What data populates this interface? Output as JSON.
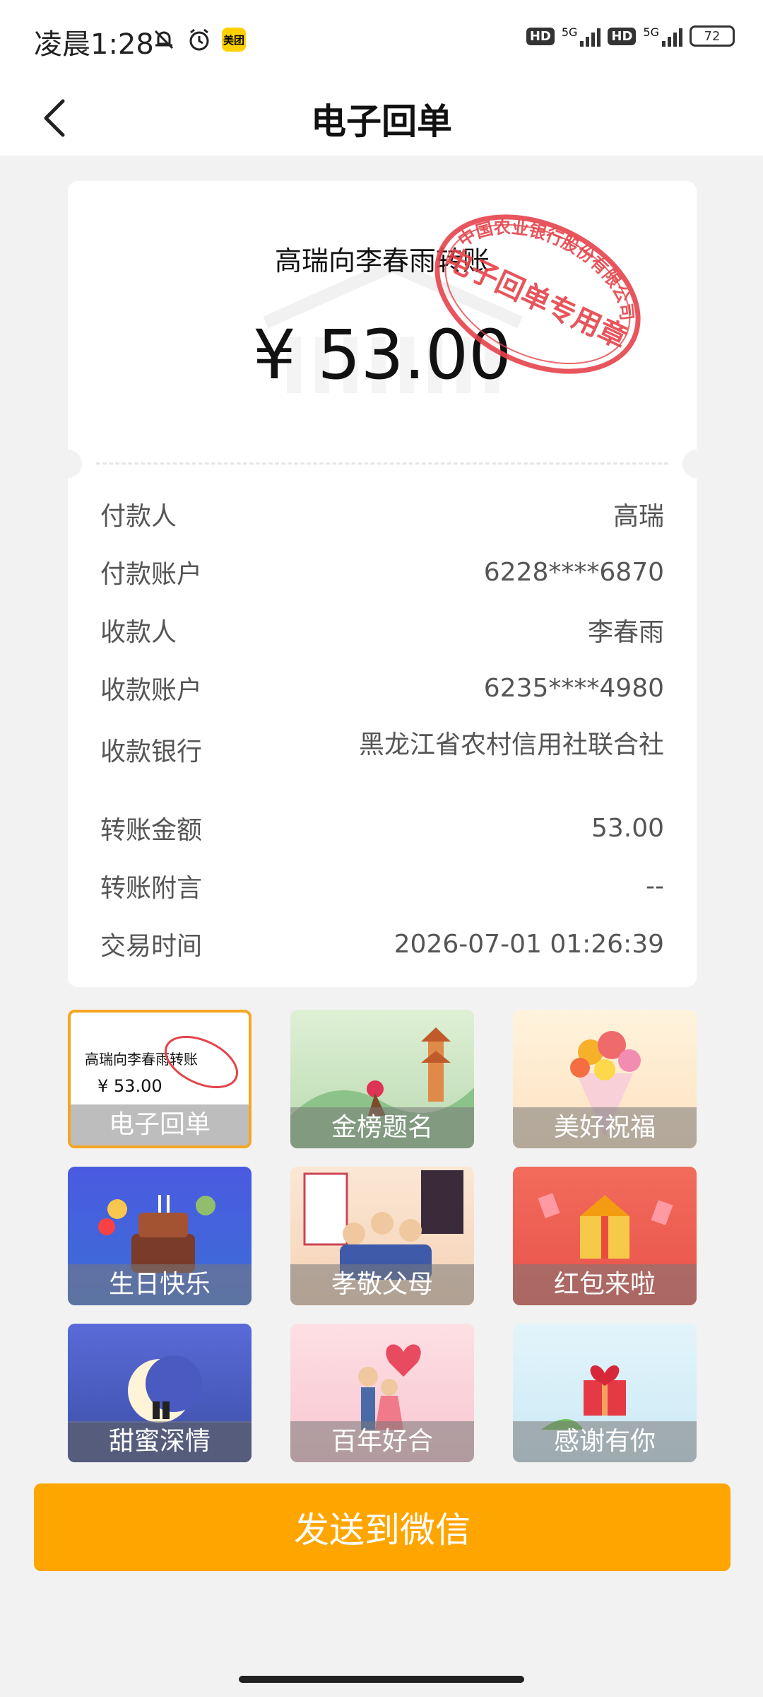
{
  "status_bar": {
    "time": "凌晨1:28",
    "meituan_label": "美团",
    "hd1": "HD",
    "hd2": "HD",
    "net1": "5G",
    "net2": "5G",
    "battery": "72"
  },
  "nav": {
    "title": "电子回单"
  },
  "receipt": {
    "heading": "高瑞向李春雨转账",
    "amount": "¥ 53.00",
    "stamp_arc": "中国农业银行股份有限公司",
    "stamp_main": "电子回单专用章",
    "rows": [
      {
        "key": "付款人",
        "value": "高瑞"
      },
      {
        "key": "付款账户",
        "value": "6228****6870"
      },
      {
        "key": "收款人",
        "value": "李春雨"
      },
      {
        "key": "收款账户",
        "value": "6235****4980"
      },
      {
        "key": "收款银行",
        "value": "黑龙江省农村信用社联合社"
      },
      {
        "key": "转账金额",
        "value": "53.00"
      },
      {
        "key": "转账附言",
        "value": "--"
      },
      {
        "key": "交易时间",
        "value": "2026-07-01 01:26:39"
      }
    ]
  },
  "templates": {
    "selected_preview": {
      "title": "高瑞向李春雨转账",
      "amount": "¥ 53.00"
    },
    "items": [
      {
        "label": "电子回单"
      },
      {
        "label": "金榜题名"
      },
      {
        "label": "美好祝福"
      },
      {
        "label": "生日快乐"
      },
      {
        "label": "孝敬父母"
      },
      {
        "label": "红包来啦"
      },
      {
        "label": "甜蜜深情"
      },
      {
        "label": "百年好合"
      },
      {
        "label": "感谢有你"
      }
    ]
  },
  "actions": {
    "send_label": "发送到微信"
  },
  "colors": {
    "accent": "#ffa500",
    "stamp": "#e5434a",
    "selected_border": "#f5a623"
  }
}
